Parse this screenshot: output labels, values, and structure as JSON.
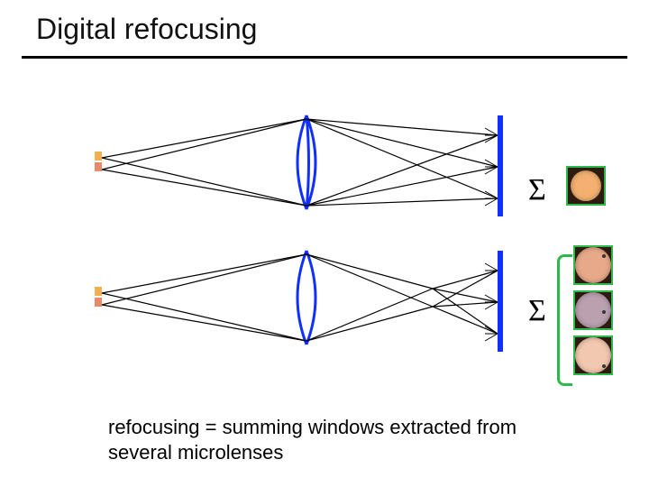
{
  "title": "Digital refocusing",
  "caption": "refocusing  =  summing windows extracted from several microlenses",
  "sigma": {
    "top": "Σ",
    "bottom": "Σ"
  },
  "patches": {
    "focused": {
      "border": "#2fb84a",
      "bg": "#2b1b10",
      "disc_color": "#f3b070",
      "disc_size": 34
    },
    "blur_a": {
      "border": "#2fb84a",
      "bg": "#2b1b10",
      "disc_color": "#e8a98a",
      "disc_size": 40
    },
    "blur_b": {
      "border": "#2fb84a",
      "bg": "#2b1b10",
      "disc_color": "#bba0b0",
      "disc_size": 40
    },
    "blur_c": {
      "border": "#2fb84a",
      "bg": "#2b1b10",
      "disc_color": "#f3c8b0",
      "disc_size": 40
    }
  },
  "optics": {
    "lens_stroke": "#1030ff",
    "sensor_stroke": "#1030ff",
    "ray_stroke": "#000000",
    "obj_colors": [
      "#ff6a2a",
      "#f0b050",
      "#e88a6a"
    ]
  }
}
